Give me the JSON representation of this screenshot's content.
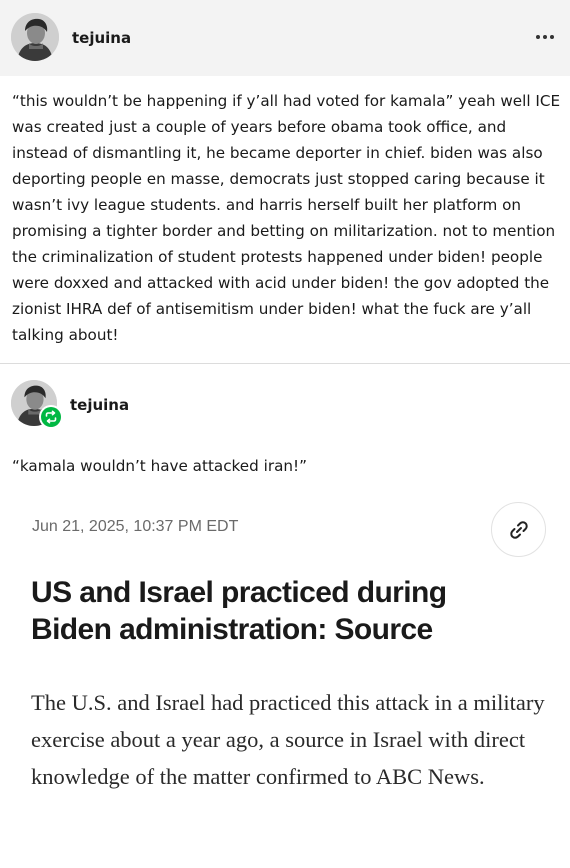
{
  "post": {
    "author": "tejuina",
    "body": "“this wouldn’t be happening if y’all had voted for kamala” yeah well ICE was created just a couple of years before obama took office, and instead of dismantling it, he became deporter in chief. biden was also deporting people en masse, democrats just stopped caring because it wasn’t ivy league students. and harris herself built her platform on promising a tighter border and betting on militarization. not to mention the criminalization of student protests happened under biden! people were doxxed and attacked with acid under biden! the gov adopted the zionist IHRA def of antisemitism under biden! what the fuck are y’all talking about!"
  },
  "reblog": {
    "author": "tejuina",
    "text": "“kamala wouldn’t have attacked iran!”",
    "badge_color": "#00b843"
  },
  "article": {
    "date": "Jun 21, 2025, 10:37 PM EDT",
    "headline": "US and Israel practiced during Biden administration: Source",
    "lede": "The U.S. and Israel had practiced this attack in a military exercise about a year ago, a source in Israel with direct knowledge of the matter confirmed to ABC News."
  },
  "icons": {
    "more": "more-options-icon",
    "reblog": "reblog-icon",
    "link": "link-icon"
  }
}
